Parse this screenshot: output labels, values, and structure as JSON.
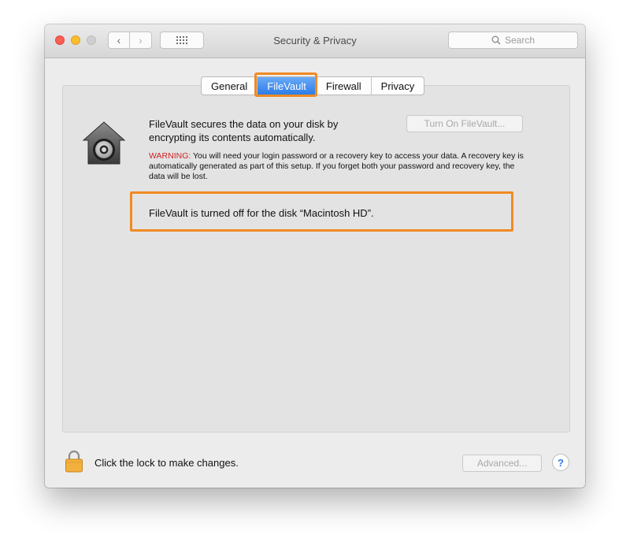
{
  "window": {
    "title": "Security & Privacy"
  },
  "toolbar": {
    "back_glyph": "‹",
    "forward_glyph": "›",
    "search_placeholder": "Search"
  },
  "tabs": [
    {
      "label": "General"
    },
    {
      "label": "FileVault"
    },
    {
      "label": "Firewall"
    },
    {
      "label": "Privacy"
    }
  ],
  "filevault": {
    "description": "FileVault secures the data on your disk by encrypting its contents automatically.",
    "turn_on_button": "Turn On FileVault...",
    "warning_prefix": "WARNING:",
    "warning_text": " You will need your login password or a recovery key to access your data. A recovery key is automatically generated as part of this setup. If you forget both your password and recovery key, the data will be lost.",
    "status": "FileVault is turned off for the disk “Macintosh HD”."
  },
  "footer": {
    "lock_message": "Click the lock to make changes.",
    "advanced_button": "Advanced...",
    "help_glyph": "?"
  },
  "colors": {
    "highlight": "#f08a24",
    "active_tab": "#2d7de8",
    "warning": "#d11f1f"
  }
}
